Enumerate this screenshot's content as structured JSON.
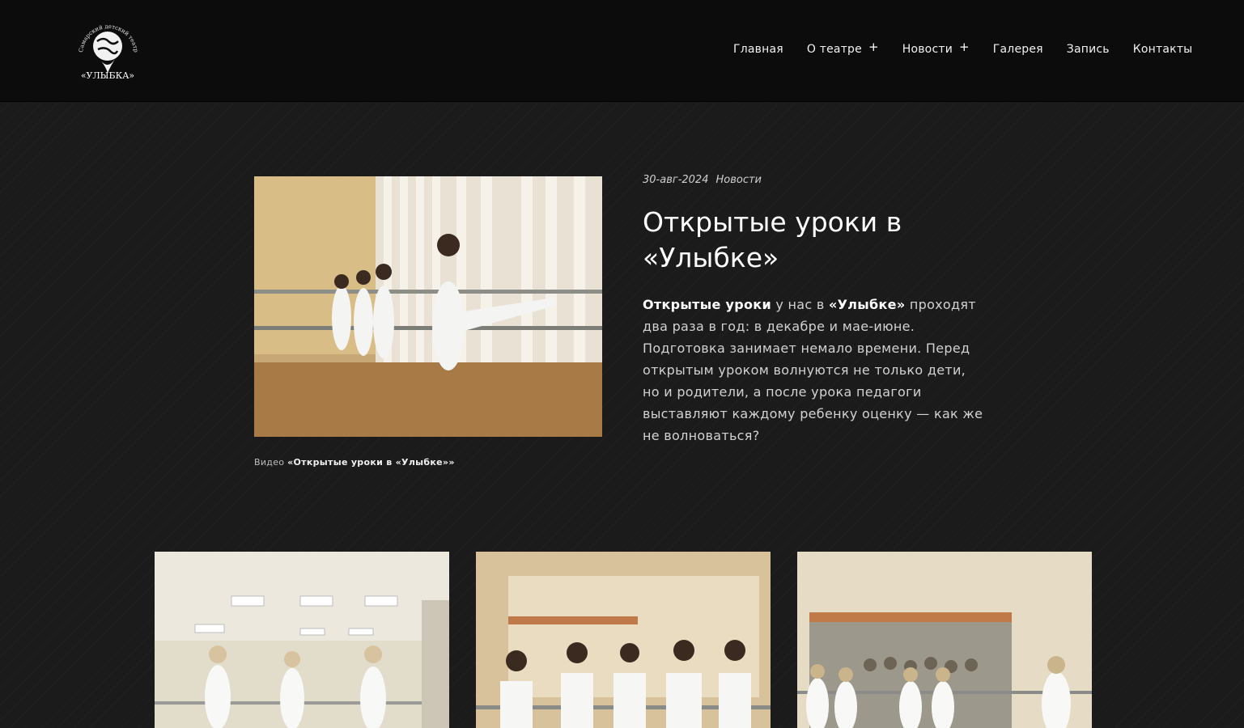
{
  "logo": {
    "arc_text": "Самарский детский театр танца",
    "name": "«УЛЫБКА»"
  },
  "nav": {
    "items": [
      {
        "label": "Главная",
        "has_submenu": false
      },
      {
        "label": "О театре",
        "has_submenu": true
      },
      {
        "label": "Новости",
        "has_submenu": true
      },
      {
        "label": "Галерея",
        "has_submenu": false
      },
      {
        "label": "Запись",
        "has_submenu": false
      },
      {
        "label": "Контакты",
        "has_submenu": false
      }
    ],
    "submenu_glyph": "+"
  },
  "article": {
    "date": "30-авг-2024",
    "category": "Новости",
    "title": "Открытые уроки в «Улыбке»",
    "body_lead_bold": "Открытые уроки",
    "body_part1": " у нас в ",
    "body_bold2": "«Улыбке»",
    "body_part2": " проходят два раза в год: в декабре и мае-июне. Подготовка занимает немало времени. Перед открытым уроком волнуются не только дети, но и родители, а после урока педагоги выставляют каждому ребенку оценку — как же не волноваться?"
  },
  "video": {
    "caption_prefix": "Видео",
    "caption_title": "«Открытые уроки в «Улыбке»»"
  },
  "colors": {
    "header_bg": "#0c0c0c",
    "page_bg": "#1b1b1b",
    "text": "#ffffff"
  }
}
